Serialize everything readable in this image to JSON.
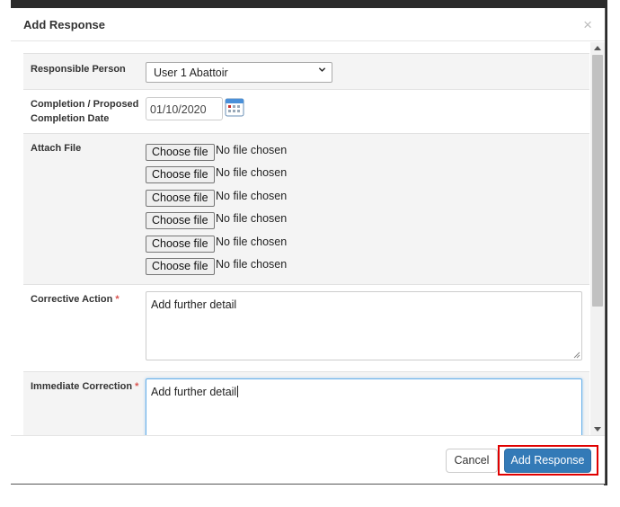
{
  "modal": {
    "title": "Add Response",
    "close_symbol": "×"
  },
  "form": {
    "responsible_person": {
      "label": "Responsible Person",
      "selected": "User 1 Abattoir"
    },
    "completion_date": {
      "label_line1": "Completion / Proposed",
      "label_line2": "Completion Date",
      "value": "01/10/2020",
      "icon": "calendar-icon"
    },
    "attach_file": {
      "label": "Attach File",
      "inputs": [
        {
          "button": "Choose file",
          "status": "No file chosen"
        },
        {
          "button": "Choose file",
          "status": "No file chosen"
        },
        {
          "button": "Choose file",
          "status": "No file chosen"
        },
        {
          "button": "Choose file",
          "status": "No file chosen"
        },
        {
          "button": "Choose file",
          "status": "No file chosen"
        },
        {
          "button": "Choose file",
          "status": "No file chosen"
        }
      ]
    },
    "corrective_action": {
      "label": "Corrective Action",
      "required_mark": "*",
      "value": "Add further detail"
    },
    "immediate_correction": {
      "label": "Immediate Correction",
      "required_mark": "*",
      "value": "Add further detail"
    }
  },
  "footer": {
    "cancel_label": "Cancel",
    "submit_label": "Add Response"
  },
  "colors": {
    "primary": "#337ab7",
    "highlight": "#e00000",
    "required": "#d9534f"
  }
}
